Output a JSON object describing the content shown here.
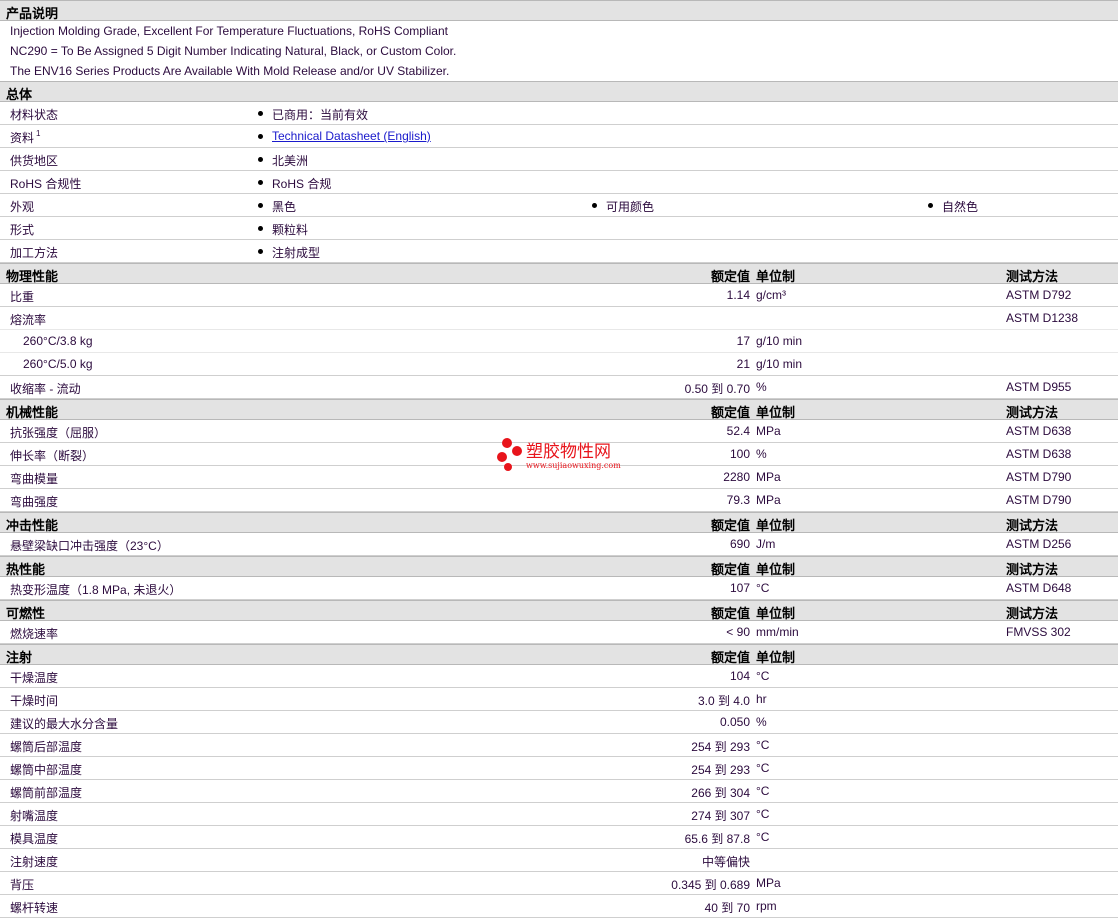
{
  "description": {
    "title": "产品说明",
    "lines": [
      "Injection Molding Grade, Excellent For Temperature Fluctuations, RoHS Compliant",
      "NC290 = To Be Assigned 5 Digit Number Indicating Natural, Black, or Custom Color.",
      "The ENV16 Series Products Are Available With Mold Release and/or UV Stabilizer."
    ]
  },
  "general": {
    "title": "总体",
    "rows": [
      {
        "label": "材料状态",
        "items": [
          "已商用：当前有效"
        ]
      },
      {
        "label": "资料",
        "sup": "1",
        "items": [
          "Technical Datasheet (English)"
        ],
        "link": true
      },
      {
        "label": "供货地区",
        "items": [
          "北美洲"
        ]
      },
      {
        "label": "RoHS 合规性",
        "items": [
          "RoHS 合规"
        ]
      },
      {
        "label": "外观",
        "items": [
          "黑色",
          "可用颜色",
          "自然色"
        ]
      },
      {
        "label": "形式",
        "items": [
          "颗粒料"
        ]
      },
      {
        "label": "加工方法",
        "items": [
          "注射成型"
        ]
      }
    ]
  },
  "headers": {
    "value": "额定值",
    "unit": "单位制",
    "method": "测试方法"
  },
  "sections": [
    {
      "title": "物理性能",
      "methods": true,
      "rows": [
        {
          "label": "比重",
          "value": "1.14",
          "unit": "g/cm³",
          "method": "ASTM D792"
        },
        {
          "label": "熔流率",
          "value": "",
          "unit": "",
          "method": "ASTM D1238",
          "light": true
        },
        {
          "label": "260°C/3.8 kg",
          "indent": true,
          "value": "17",
          "unit": "g/10 min",
          "method": "",
          "light": true
        },
        {
          "label": "260°C/5.0 kg",
          "indent": true,
          "value": "21",
          "unit": "g/10 min",
          "method": ""
        },
        {
          "label": "收缩率 - 流动",
          "value": "0.50 到  0.70",
          "unit": "%",
          "method": "ASTM D955"
        }
      ]
    },
    {
      "title": "机械性能",
      "methods": true,
      "rows": [
        {
          "label": "抗张强度（屈服）",
          "value": "52.4",
          "unit": "MPa",
          "method": "ASTM D638"
        },
        {
          "label": "伸长率（断裂）",
          "value": "100",
          "unit": "%",
          "method": "ASTM D638"
        },
        {
          "label": "弯曲模量",
          "value": "2280",
          "unit": "MPa",
          "method": "ASTM D790"
        },
        {
          "label": "弯曲强度",
          "value": "79.3",
          "unit": "MPa",
          "method": "ASTM D790"
        }
      ]
    },
    {
      "title": "冲击性能",
      "methods": true,
      "rows": [
        {
          "label": "悬壁梁缺口冲击强度（23°C）",
          "value": "690",
          "unit": "J/m",
          "method": "ASTM D256"
        }
      ]
    },
    {
      "title": "热性能",
      "methods": true,
      "rows": [
        {
          "label": "热变形温度（1.8 MPa, 未退火）",
          "value": "107",
          "unit": "°C",
          "method": "ASTM D648"
        }
      ]
    },
    {
      "title": "可燃性",
      "methods": true,
      "rows": [
        {
          "label": "燃烧速率",
          "value": "< 90",
          "unit": "mm/min",
          "method": "FMVSS 302"
        }
      ]
    },
    {
      "title": "注射",
      "methods": false,
      "rows": [
        {
          "label": "干燥温度",
          "value": "104",
          "unit": "°C"
        },
        {
          "label": "干燥时间",
          "value": "3.0 到  4.0",
          "unit": "hr"
        },
        {
          "label": "建议的最大水分含量",
          "value": "0.050",
          "unit": "%"
        },
        {
          "label": "螺筒后部温度",
          "value": "254 到  293",
          "unit": "°C"
        },
        {
          "label": "螺筒中部温度",
          "value": "254 到  293",
          "unit": "°C"
        },
        {
          "label": "螺筒前部温度",
          "value": "266 到  304",
          "unit": "°C"
        },
        {
          "label": "射嘴温度",
          "value": "274 到  307",
          "unit": "°C"
        },
        {
          "label": "模具温度",
          "value": "65.6 到  87.8",
          "unit": "°C"
        },
        {
          "label": "注射速度",
          "value": "中等偏快",
          "unit": ""
        },
        {
          "label": "背压",
          "value": "0.345 到  0.689",
          "unit": "MPa"
        },
        {
          "label": "螺杆转速",
          "value": "40 到  70",
          "unit": "rpm"
        }
      ]
    }
  ],
  "watermark": {
    "name": "塑胶物性网",
    "url": "www.sujiaowuxing.com"
  }
}
